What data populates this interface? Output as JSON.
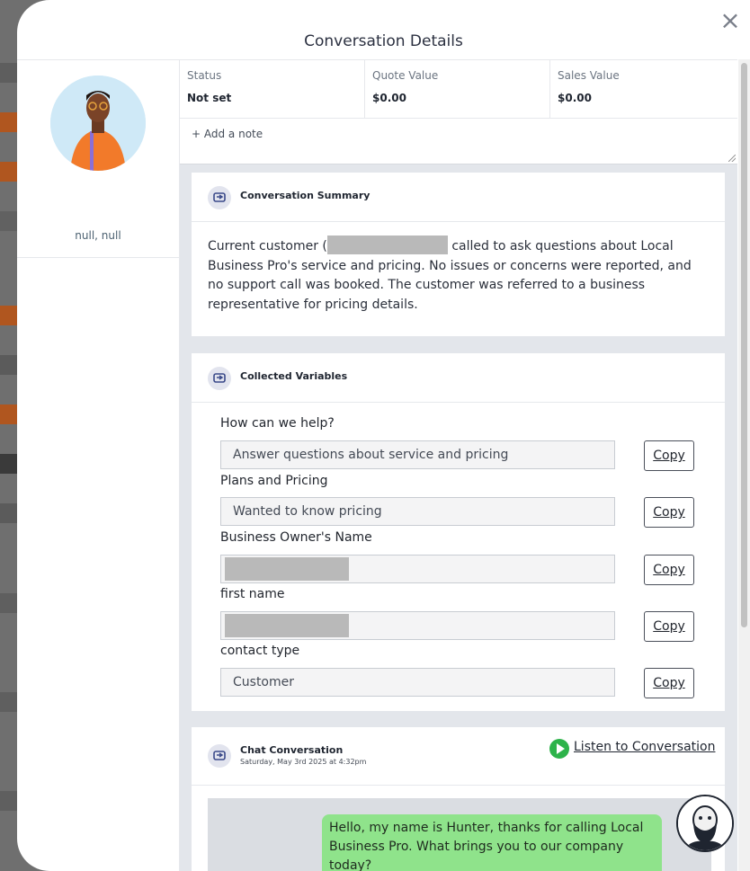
{
  "modal": {
    "title": "Conversation Details",
    "close_icon": "close-icon"
  },
  "contact": {
    "name": "null, null"
  },
  "stats": [
    {
      "label": "Status",
      "value": "Not set"
    },
    {
      "label": "Quote Value",
      "value": "$0.00"
    },
    {
      "label": "Sales Value",
      "value": "$0.00"
    }
  ],
  "note": {
    "add_label": "+ Add a note"
  },
  "summary": {
    "title": "Conversation Summary",
    "text_before": "Current customer (",
    "text_after": " called to ask questions about Local Business Pro's service and pricing. No issues or concerns were reported, and no support call was booked. The customer was referred to a business representative for pricing details."
  },
  "variables": {
    "title": "Collected Variables",
    "copy_label": "Copy",
    "items": [
      {
        "label": "How can we help?",
        "value": "Answer questions about service and pricing"
      },
      {
        "label": "Plans and Pricing",
        "value": "Wanted to know pricing"
      },
      {
        "label": "Business Owner's Name",
        "value": ""
      },
      {
        "label": "first name",
        "value": ""
      },
      {
        "label": "contact type",
        "value": "Customer"
      }
    ]
  },
  "chat": {
    "title": "Chat Conversation",
    "date": "Saturday, May 3rd 2025 at 4:32pm",
    "listen_label": "Listen to Conversation",
    "messages": [
      {
        "text": "Hello, my name is Hunter, thanks for calling Local Business Pro. What brings you to our company today?"
      }
    ]
  },
  "colors": {
    "accent_green": "#2db34a",
    "bubble_green": "#8fe38b",
    "panel_gray": "#e3e6eb"
  }
}
